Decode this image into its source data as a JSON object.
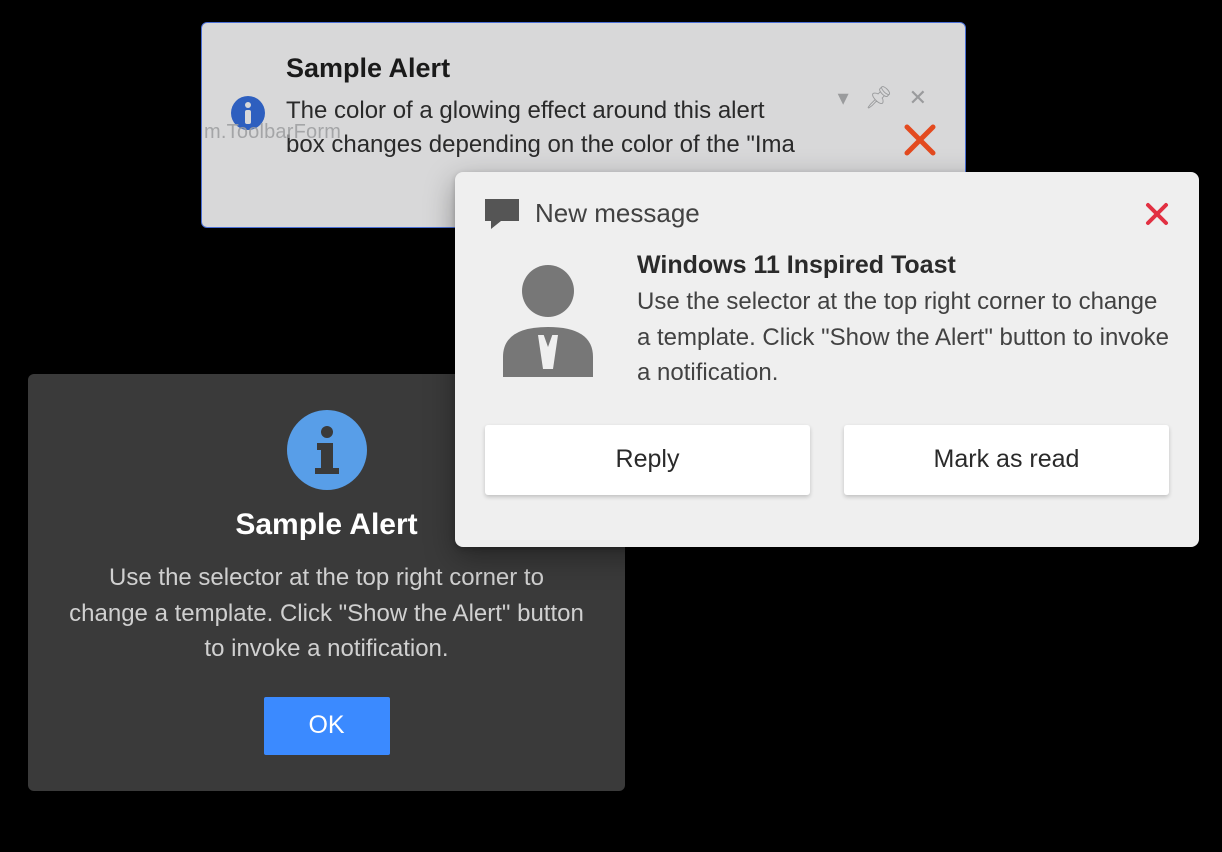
{
  "alert1": {
    "title": "Sample Alert",
    "body": "The color of a glowing effect around this alert box changes depending on the color of the \"Ima",
    "background_text": "m.ToolbarForm",
    "icon": "info-icon",
    "close_icon": "close-icon",
    "colors": {
      "close_x": "#e34a1f",
      "info": "#2e5fbf",
      "border": "#4a6fd6"
    }
  },
  "alert2": {
    "title": "Sample Alert",
    "body": "Use the selector at the top right corner to change a template. Click \"Show the Alert\" button to invoke a notification.",
    "icon": "info-icon",
    "ok_label": "OK",
    "colors": {
      "info": "#589ee8",
      "ok_bg": "#3b8aff"
    }
  },
  "alert3": {
    "header_title": "New message",
    "title": "Windows 11 Inspired Toast",
    "body": "Use the selector at the top right corner to change a template. Click \"Show the Alert\" button to invoke a notification.",
    "reply_label": "Reply",
    "mark_read_label": "Mark as read",
    "header_icon": "chat-icon",
    "avatar_icon": "avatar-icon",
    "close_icon": "close-icon",
    "colors": {
      "close_x": "#e23042"
    }
  }
}
